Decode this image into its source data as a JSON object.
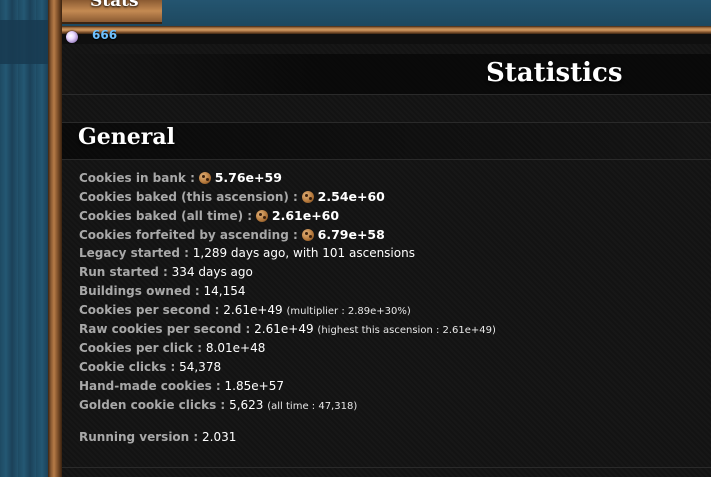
{
  "tab": {
    "label": "Stats"
  },
  "lumps": {
    "count": "666"
  },
  "page": {
    "title": "Statistics"
  },
  "general": {
    "title": "General",
    "rows": [
      {
        "label": "Cookies in bank :",
        "value": "5.76e+59",
        "icon": "cookie-icon"
      },
      {
        "label": "Cookies baked (this ascension) :",
        "value": "2.54e+60",
        "icon": "cookie-icon"
      },
      {
        "label": "Cookies baked (all time) :",
        "value": "2.61e+60",
        "icon": "cookie-icon"
      },
      {
        "label": "Cookies forfeited by ascending :",
        "value": "6.79e+58",
        "icon": "cookie-icon"
      },
      {
        "label": "Legacy started :",
        "value": "1,289 days ago, with 101 ascensions"
      },
      {
        "label": "Run started :",
        "value": "334 days ago"
      },
      {
        "label": "Buildings owned :",
        "value": "14,154"
      },
      {
        "label": "Cookies per second :",
        "value": "2.61e+49",
        "note": "(multiplier : 2.89e+30%)"
      },
      {
        "label": "Raw cookies per second :",
        "value": "2.61e+49",
        "note": "(highest this ascension : 2.61e+49)"
      },
      {
        "label": "Cookies per click :",
        "value": "8.01e+48"
      },
      {
        "label": "Cookie clicks :",
        "value": "54,378"
      },
      {
        "label": "Hand-made cookies :",
        "value": "1.85e+57"
      },
      {
        "label": "Golden cookie clicks :",
        "value": "5,623",
        "note": "(all time : 47,318)"
      }
    ],
    "version": {
      "label": "Running version :",
      "value": "2.031"
    }
  }
}
